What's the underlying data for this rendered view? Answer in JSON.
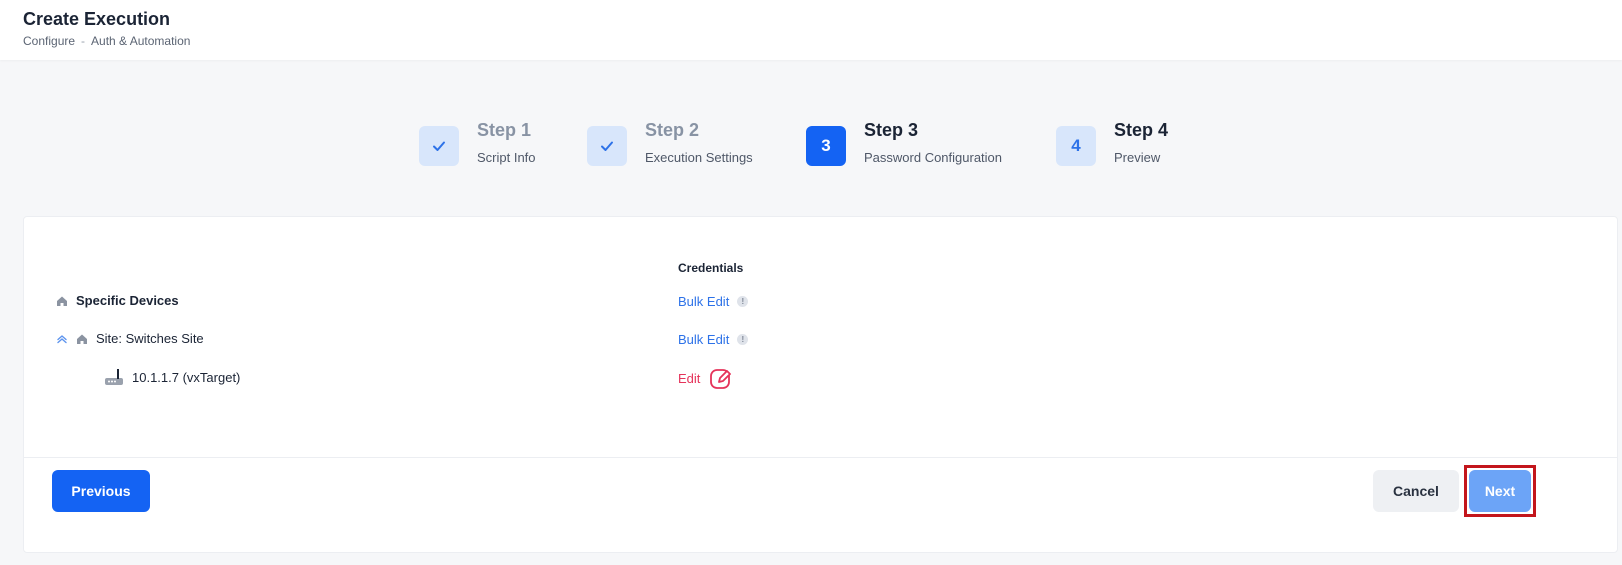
{
  "header": {
    "title": "Create Execution",
    "breadcrumb": [
      "Configure",
      "Auth & Automation"
    ],
    "breadcrumb_sep": "-"
  },
  "stepper": {
    "steps": [
      {
        "badge": "✓",
        "title": "Step 1",
        "subtitle": "Script Info",
        "state": "done"
      },
      {
        "badge": "✓",
        "title": "Step 2",
        "subtitle": "Execution Settings",
        "state": "done"
      },
      {
        "badge": "3",
        "title": "Step 3",
        "subtitle": "Password Configuration",
        "state": "active"
      },
      {
        "badge": "4",
        "title": "Step 4",
        "subtitle": "Preview",
        "state": "todo"
      }
    ]
  },
  "table": {
    "credentials_header": "Credentials",
    "rows": [
      {
        "label": "Specific Devices",
        "action": "Bulk Edit",
        "info": "!"
      },
      {
        "label": "Site: Switches Site",
        "action": "Bulk Edit",
        "info": "!"
      },
      {
        "label": "10.1.1.7 (vxTarget)",
        "action": "Edit"
      }
    ]
  },
  "footer": {
    "previous_label": "Previous",
    "cancel_label": "Cancel",
    "next_label": "Next"
  },
  "colors": {
    "primary": "#1463f3",
    "link": "#2d72e8",
    "danger": "#e5335a",
    "next_highlight_border": "#c3161c"
  }
}
